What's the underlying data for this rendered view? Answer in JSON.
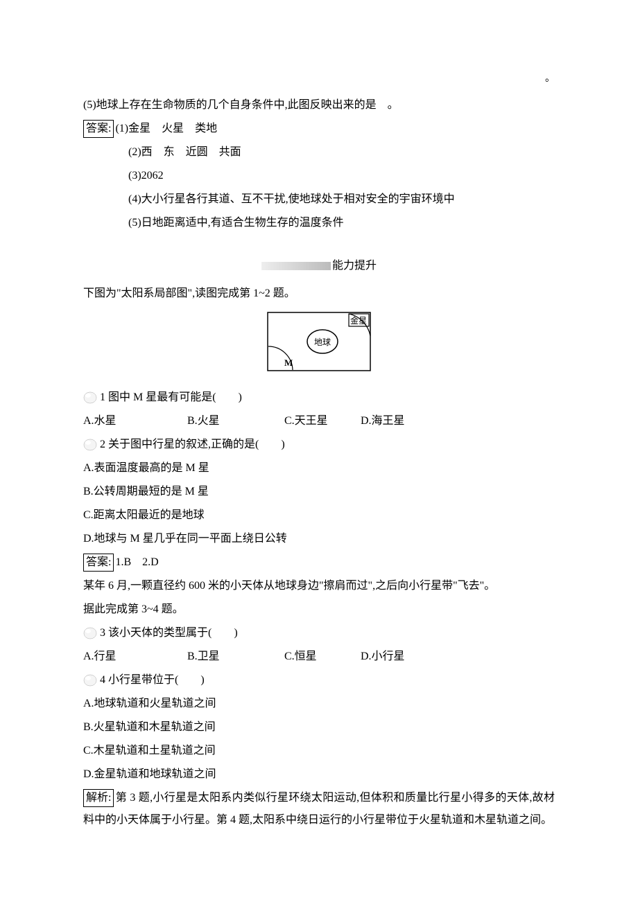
{
  "top_marker": "　。",
  "q5_text": "(5)地球上存在生命物质的几个自身条件中,此图反映出来的是　。",
  "answer_label": "答案:",
  "answers": {
    "a1": "(1)金星　火星　类地",
    "a2": "(2)西　东　近圆　共面",
    "a3": "(3)2062",
    "a4": "(4)大小行星各行其道、互不干扰,使地球处于相对安全的宇宙环境中",
    "a5": "(5)日地距离适中,有适合生物生存的温度条件"
  },
  "section_title": "能力提升",
  "intro1": "下图为\"太阳系局部图\",读图完成第 1~2 题。",
  "diagram": {
    "venus": "金星",
    "earth": "地球",
    "m_label": "M"
  },
  "q1": {
    "text": "1 图中 M 星最有可能是(　　)",
    "a": "A.水星",
    "b": "B.火星",
    "c": "C.天王星",
    "d": "D.海王星"
  },
  "q2": {
    "text": "2 关于图中行星的叙述,正确的是(　　)",
    "a": "A.表面温度最高的是 M 星",
    "b": "B.公转周期最短的是 M 星",
    "c": "C.距离太阳最近的是地球",
    "d": "D.地球与 M 星几乎在同一平面上绕日公转"
  },
  "answer12": "1.B　2.D",
  "intro2a": "某年 6 月,一颗直径约 600 米的小天体从地球身边\"擦肩而过\",之后向小行星带\"飞去\"。",
  "intro2b": "据此完成第 3~4 题。",
  "q3": {
    "text": "3 该小天体的类型属于(　　)",
    "a": "A.行星",
    "b": "B.卫星",
    "c": "C.恒星",
    "d": "D.小行星"
  },
  "q4": {
    "text": "4 小行星带位于(　　)",
    "a": "A.地球轨道和火星轨道之间",
    "b": "B.火星轨道和木星轨道之间",
    "c": "C.木星轨道和土星轨道之间",
    "d": "D.金星轨道和地球轨道之间"
  },
  "analysis_label": "解析:",
  "analysis_text": "第 3 题,小行星是太阳系内类似行星环绕太阳运动,但体积和质量比行星小得多的天体,故材料中的小天体属于小行星。第 4 题,太阳系中绕日运行的小行星带位于火星轨道和木星轨道之间。"
}
